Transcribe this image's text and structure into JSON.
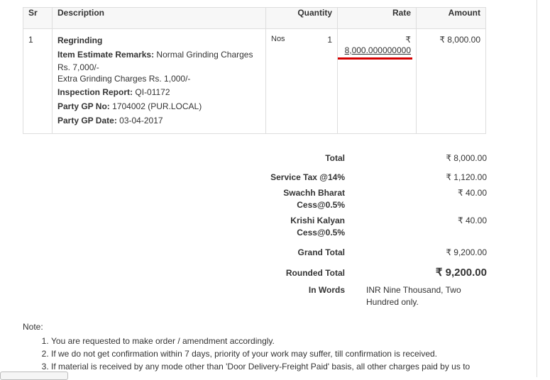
{
  "table": {
    "headers": {
      "sr": "Sr",
      "description": "Description",
      "quantity": "Quantity",
      "rate": "Rate",
      "amount": "Amount"
    },
    "row": {
      "sr": "1",
      "item": "Regrinding",
      "remarks_label": "Item Estimate Remarks:",
      "remarks_value": "Normal Grinding Charges",
      "remarks_line2": "Rs. 7,000/-",
      "remarks_line3": "Extra Grinding Charges Rs. 1,000/-",
      "inspection_label": "Inspection Report:",
      "inspection_value": "QI-01172",
      "party_gp_label": "Party GP No:",
      "party_gp_value": "1704002 (PUR.LOCAL)",
      "party_gp_date_label": "Party GP Date:",
      "party_gp_date_value": "03-04-2017",
      "uom": "Nos",
      "qty": "1",
      "rate_symbol": "₹",
      "rate": "8,000.000000000",
      "amount": "₹ 8,000.00"
    }
  },
  "totals": {
    "total_label": "Total",
    "total_value": "₹ 8,000.00",
    "service_tax_label": "Service Tax @14%",
    "service_tax_value": "₹ 1,120.00",
    "swachh_label_1": "Swachh Bharat",
    "swachh_label_2": "Cess@0.5%",
    "swachh_value": "₹ 40.00",
    "krishi_label_1": "Krishi Kalyan",
    "krishi_label_2": "Cess@0.5%",
    "krishi_value": "₹ 40.00",
    "grand_label": "Grand Total",
    "grand_value": "₹ 9,200.00",
    "rounded_label": "Rounded Total",
    "rounded_value": "₹ 9,200.00",
    "words_label": "In Words",
    "words_line1": "INR Nine Thousand, Two",
    "words_line2": "Hundred only."
  },
  "notes": {
    "title": "Note:",
    "items": [
      "You are requested to make order / amendment accordingly.",
      "If we do not get confirmation within 7 days, priority of your work may suffer, till confirmation is received.",
      "If material is received by any mode other than 'Door Delivery-Freight Paid' basis, all other charges paid by us to"
    ]
  },
  "accent": "#d50000"
}
